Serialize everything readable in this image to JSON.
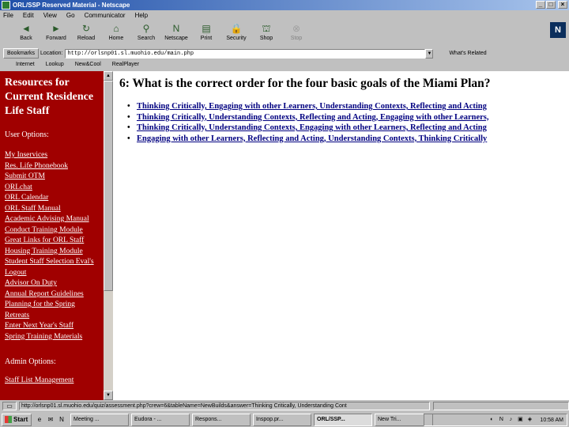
{
  "window": {
    "title": "ORL/SSP Reserved Material - Netscape",
    "controls": [
      "_",
      "□",
      "×"
    ]
  },
  "menu": [
    "File",
    "Edit",
    "View",
    "Go",
    "Communicator",
    "Help"
  ],
  "toolbar": [
    {
      "label": "Back",
      "icon": "back-arrow-icon",
      "glyph": "◄"
    },
    {
      "label": "Forward",
      "icon": "forward-arrow-icon",
      "glyph": "►"
    },
    {
      "label": "Reload",
      "icon": "reload-icon",
      "glyph": "↻"
    },
    {
      "label": "Home",
      "icon": "home-icon",
      "glyph": "⌂"
    },
    {
      "label": "Search",
      "icon": "search-icon",
      "glyph": "⚲"
    },
    {
      "label": "Netscape",
      "icon": "netscape-icon",
      "glyph": "N"
    },
    {
      "label": "Print",
      "icon": "print-icon",
      "glyph": "▤"
    },
    {
      "label": "Security",
      "icon": "lock-icon",
      "glyph": "🔒"
    },
    {
      "label": "Shop",
      "icon": "shop-icon",
      "glyph": "⛫"
    },
    {
      "label": "Stop",
      "icon": "stop-icon",
      "glyph": "⊗"
    }
  ],
  "brand": "N",
  "location": {
    "bookmarks_label": "Bookmarks",
    "label": "Location:",
    "value": "http://orlsnp01.sl.muohio.edu/main.php",
    "related_label": "What's Related"
  },
  "personal_toolbar": [
    "Internet",
    "Lookup",
    "New&Cool",
    "RealPlayer"
  ],
  "sidebar": {
    "title": "Resources for Current Residence Life Staff",
    "user_options_heading": "User Options:",
    "links": [
      "My Inservices",
      "Res. Life Phonebook",
      "Submit OTM",
      "ORLchat",
      "ORL Calendar",
      "ORL Staff Manual",
      "Academic Advising Manual",
      "Conduct Training Module",
      "Great Links for ORL Staff",
      "Housing Training Module",
      "Student Staff Selection Eval's",
      "Logout",
      "Advisor On Duty",
      "Annual Report Guidelines",
      "Planning for the Spring",
      "Retreats",
      "Enter Next Year's Staff",
      "Spring Training Materials"
    ],
    "admin_options_heading": "Admin Options:",
    "admin_links": [
      "Staff List Management"
    ]
  },
  "main": {
    "question": "6: What is the correct order for the four basic goals of the Miami Plan?",
    "answers": [
      "Thinking Critically, Engaging with other Learners, Understanding Contexts, Reflecting and Acting",
      "Thinking Critically, Understanding Contexts, Reflecting and Acting, Engaging with other Learners,",
      "Thinking Critically, Understanding Contexts, Engaging with other Learners, Reflecting and Acting",
      "Engaging with other Learners, Reflecting and Acting, Understanding Contexts, Thinking Critically"
    ]
  },
  "status": {
    "text": "http://orlsnp01.sl.muohio.edu/quiz/assessment.php?crew=6&tableName=NewBuilds&answer=Thinking Critically, Understanding Cont"
  },
  "taskbar": {
    "start_label": "Start",
    "quicklaunch": [
      "e",
      "✉",
      "N"
    ],
    "tasks": [
      {
        "label": "Meeting ...",
        "active": false
      },
      {
        "label": "Eudora - ...",
        "active": false
      },
      {
        "label": "Respons...",
        "active": false
      },
      {
        "label": "Inspop.pr...",
        "active": false
      },
      {
        "label": "ORL/SSP...",
        "active": true
      },
      {
        "label": "New Tri...",
        "active": false
      }
    ],
    "tray_icons": [
      "◐",
      "N",
      "♪",
      "▣",
      "◈"
    ],
    "clock": "10:58 AM"
  }
}
